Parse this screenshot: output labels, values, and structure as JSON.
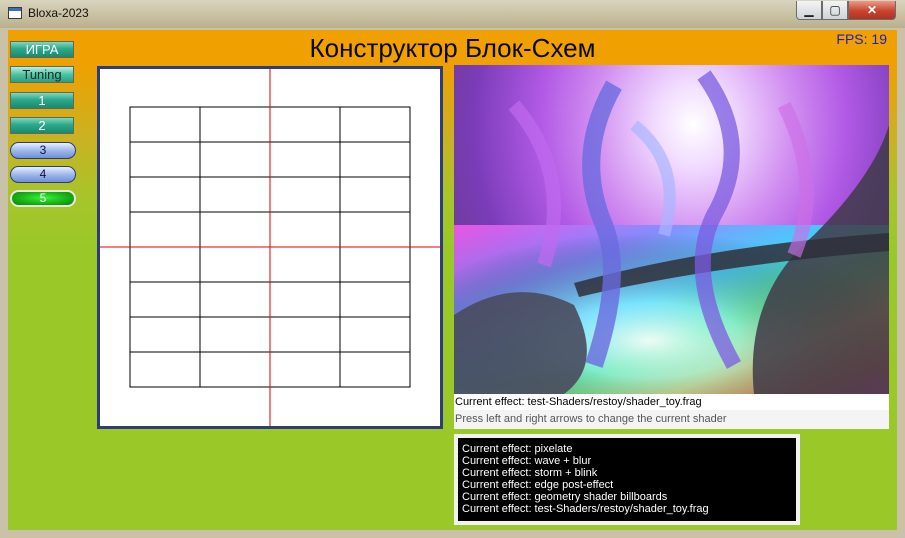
{
  "window": {
    "title": "Bloxa-2023",
    "minimize": "▁",
    "maximize": "▢",
    "close": "✕"
  },
  "header": {
    "title": "Конструктор Блок-Схем",
    "fps": "FPS: 19"
  },
  "sidebar": {
    "buttons": [
      "ИГРА",
      "Tuning",
      "1",
      "2",
      "3",
      "4",
      "5"
    ],
    "selected": "5"
  },
  "shader_panel": {
    "current_effect": "Current effect: test-Shaders/restoy/shader_toy.frag",
    "hint": "Press left and right arrows to change the current shader"
  },
  "console": {
    "lines": [
      "Current effect: pixelate",
      "Current effect: wave + blur",
      "Current effect: storm + blink",
      "Current effect: edge post-effect",
      "Current effect: geometry shader billboards",
      "Current effect: test-Shaders/restoy/shader_toy.frag"
    ]
  },
  "colors": {
    "header_bar": "#f0a000",
    "background_green": "#9ac829",
    "canvas_border": "#2e3d7a",
    "crosshair": "#e00000",
    "fps_text": "#1d1dc0"
  }
}
